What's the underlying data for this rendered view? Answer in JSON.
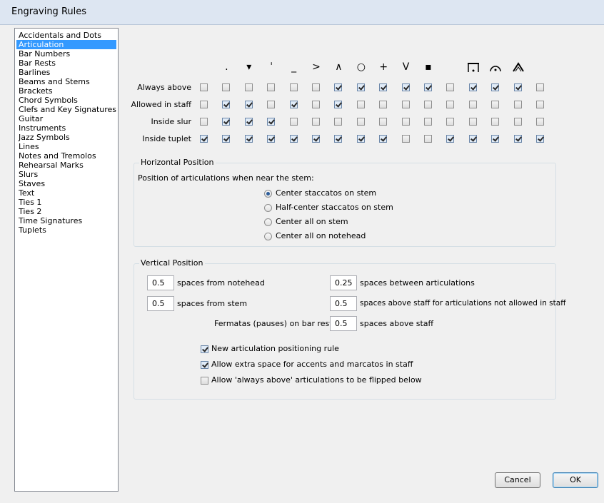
{
  "window": {
    "title": "Engraving Rules"
  },
  "categories": {
    "items": [
      "Accidentals and Dots",
      "Articulation",
      "Bar Numbers",
      "Bar Rests",
      "Barlines",
      "Beams and Stems",
      "Brackets",
      "Chord Symbols",
      "Clefs and Key Signatures",
      "Guitar",
      "Instruments",
      "Jazz Symbols",
      "Lines",
      "Notes and Tremolos",
      "Rehearsal Marks",
      "Slurs",
      "Staves",
      "Text",
      "Ties 1",
      "Ties 2",
      "Time Signatures",
      "Tuplets"
    ],
    "selected": "Articulation"
  },
  "articulations": {
    "symbol_icons": [
      "staccato-icon",
      "staccatissimo-wedge-icon",
      "staccatissimo-stroke-icon",
      "tenuto-icon",
      "accent-icon",
      "marcato-icon",
      "harmonic-icon",
      "plus-icon",
      "up-bow-icon",
      "down-bow-icon",
      "pause-icon",
      "fermata-icon",
      "square-fermata-icon",
      "triangle-fermata-icon"
    ],
    "symbol_glyphs": [
      ".",
      "▾",
      "ˈ",
      "_",
      ">",
      "∧",
      "○",
      "+",
      "V",
      "▪",
      "",
      "",
      "",
      ""
    ],
    "rows": [
      {
        "label": "Always above",
        "checks": [
          false,
          false,
          false,
          false,
          false,
          false,
          true,
          true,
          true,
          true,
          true,
          false,
          true,
          true,
          true,
          false
        ]
      },
      {
        "label": "Allowed in staff",
        "checks": [
          false,
          true,
          true,
          false,
          true,
          false,
          true,
          false,
          false,
          false,
          false,
          false,
          false,
          false,
          false,
          false
        ]
      },
      {
        "label": "Inside slur",
        "checks": [
          false,
          true,
          true,
          true,
          false,
          false,
          false,
          false,
          false,
          false,
          false,
          false,
          false,
          false,
          false,
          false
        ]
      },
      {
        "label": "Inside tuplet",
        "checks": [
          true,
          true,
          true,
          true,
          true,
          true,
          true,
          true,
          true,
          false,
          false,
          true,
          true,
          true,
          true,
          true
        ]
      }
    ]
  },
  "horizontal": {
    "group_label": "Horizontal Position",
    "prompt": "Position of articulations when near the stem:",
    "options": [
      "Center staccatos on stem",
      "Half-center staccatos on stem",
      "Center all on stem",
      "Center all on notehead"
    ],
    "selected": "Center staccatos on stem"
  },
  "vertical": {
    "group_label": "Vertical Position",
    "from_notehead": {
      "value": "0.5",
      "label": "spaces from notehead"
    },
    "between_articulations": {
      "value": "0.25",
      "label": "spaces between articulations"
    },
    "from_stem": {
      "value": "0.5",
      "label": "spaces from stem"
    },
    "above_staff_not_allowed": {
      "value": "0.5",
      "label": "spaces above staff for articulations not allowed in staff"
    },
    "fermatas_label": "Fermatas (pauses) on bar rests:",
    "fermatas": {
      "value": "0.5",
      "label": "spaces above staff"
    },
    "checkbox_options": [
      {
        "label": "New articulation positioning rule",
        "checked": true
      },
      {
        "label": "Allow extra space for accents and marcatos in staff",
        "checked": true
      },
      {
        "label": "Allow 'always above' articulations to be flipped below",
        "checked": false
      }
    ]
  },
  "buttons": {
    "cancel": "Cancel",
    "ok": "OK"
  }
}
